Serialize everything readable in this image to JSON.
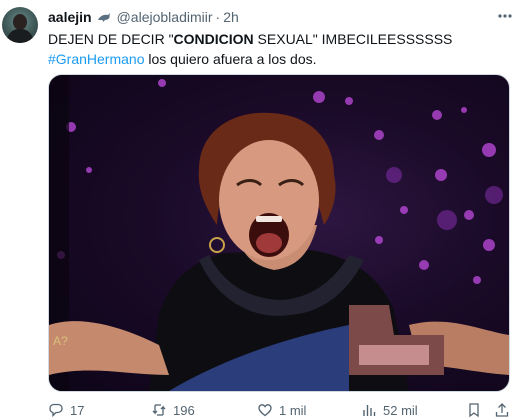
{
  "tweet": {
    "author": {
      "display_name": "aalejin",
      "handle": "@alejobladimiir",
      "time": "2h"
    },
    "text": {
      "line1_pre": "DEJEN DE DECIR \"",
      "line1_bold": "CONDICION",
      "line1_post": " SEXUAL\" IMBECILEESSSSSS",
      "hashtag": "#GranHermano",
      "line2_post": " los quiero afuera a los dos."
    },
    "media": {
      "description_icon": "image",
      "overlay_letter": "A?"
    },
    "actions": {
      "replies": "17",
      "reposts": "196",
      "likes": "1 mil",
      "views": "52 mil"
    }
  },
  "colors": {
    "text": "#0f1419",
    "muted": "#536471",
    "link": "#1d9bf0",
    "border": "#cfd9de"
  },
  "icons": [
    "verified-dolphin-icon",
    "more-icon",
    "reply-icon",
    "repost-icon",
    "like-icon",
    "views-icon",
    "bookmark-icon",
    "share-icon"
  ]
}
